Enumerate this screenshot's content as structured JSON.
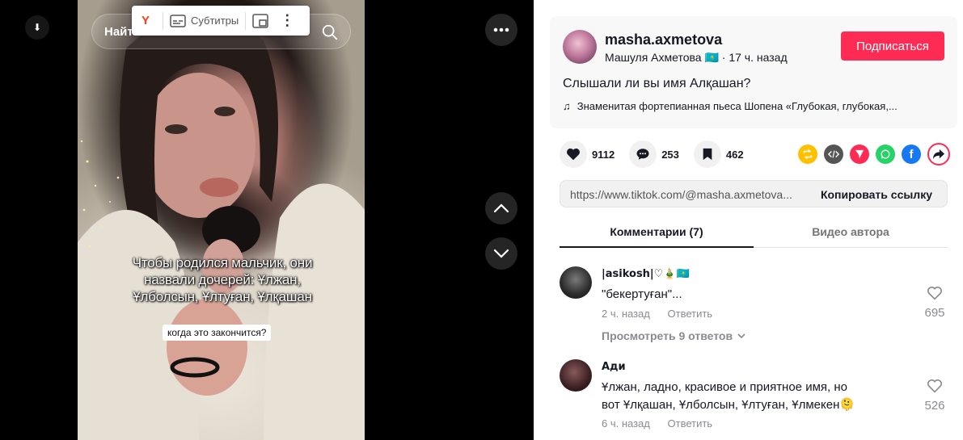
{
  "video": {
    "search_label": "Найт",
    "caption_main": "Чтобы родился мальчик, они назвали дочерей: Ұлжан, Ұлболсын, Ұлтуған, Ұлқашан",
    "caption_sub": "когда это закончится?"
  },
  "yandex_bar": {
    "logo": "Y",
    "subtitles_label": "Субтитры"
  },
  "author": {
    "username": "masha.axmetova",
    "nickname": "Машуля Ахметова 🇰🇿",
    "posted": "17 ч. назад",
    "separator": "·",
    "follow_label": "Подписаться"
  },
  "post": {
    "description": "Слышали ли вы имя Алқашан?",
    "music": "Знаменитая фортепианная пьеса Шопена «Глубокая, глубокая,..."
  },
  "stats": {
    "likes": "9112",
    "comments": "253",
    "saves": "462"
  },
  "share": {
    "link": "https://www.tiktok.com/@masha.axmetova...",
    "copy_label": "Копировать ссылку",
    "icons": [
      "repost-icon",
      "embed-icon",
      "send-icon",
      "whatsapp-icon",
      "facebook-icon",
      "share-more-icon"
    ]
  },
  "tabs": {
    "comments": "Комментарии (7)",
    "author_videos": "Видео автора"
  },
  "comments": [
    {
      "name": "|asikosh|♡🎍🇰🇿",
      "text": "\"бекертуған\"...",
      "time": "2 ч. назад",
      "reply_label": "Ответить",
      "likes": "695",
      "view_replies": "Просмотреть 9 ответов"
    },
    {
      "name": "Ади",
      "text": "Ұлжан, ладно, красивое и приятное имя, но вот Ұлқашан, Ұлболсын, Ұлтуған, Ұлмекен🫠",
      "time": "6 ч. назад",
      "reply_label": "Ответить",
      "likes": "526"
    }
  ],
  "colors": {
    "accent": "#fe2c55",
    "repost": "#ffc000",
    "embed": "#555555",
    "send": "#fe2c55",
    "whatsapp": "#25d366",
    "facebook": "#1877f2"
  }
}
